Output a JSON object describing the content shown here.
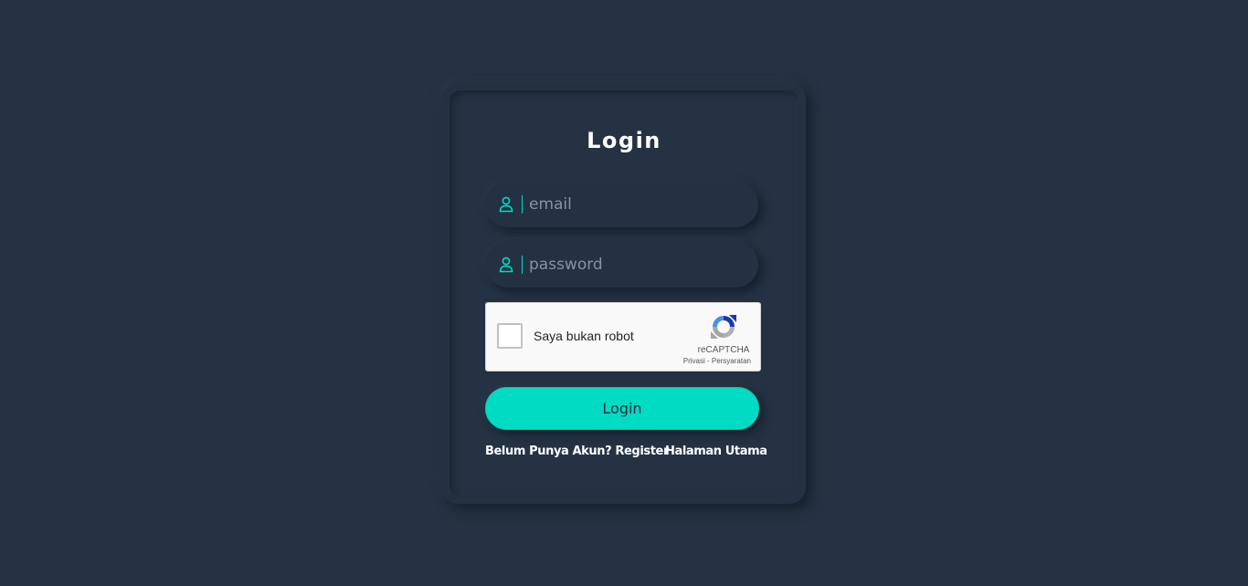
{
  "form": {
    "title": "Login",
    "email": {
      "placeholder": "email",
      "value": "",
      "icon": "user-icon"
    },
    "password": {
      "placeholder": "password",
      "value": "",
      "icon": "user-icon"
    },
    "submit_label": "Login"
  },
  "captcha": {
    "label": "Saya bukan robot",
    "brand": "reCAPTCHA",
    "privacy": "Privasi",
    "separator": " - ",
    "terms": "Persyaratan",
    "checked": false
  },
  "links": {
    "register": "Belum Punya Akun? Register",
    "home": "Halaman Utama"
  },
  "colors": {
    "background": "#243243",
    "accent": "#00dcc3",
    "text": "#ffffff",
    "placeholder": "#8793a3"
  }
}
